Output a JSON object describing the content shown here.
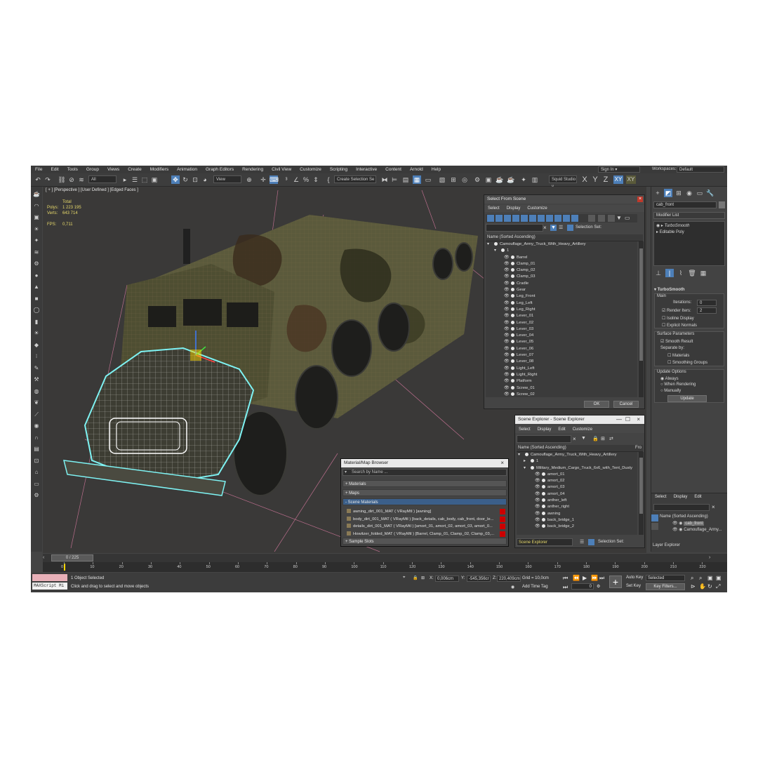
{
  "menu": [
    "File",
    "Edit",
    "Tools",
    "Group",
    "Views",
    "Create",
    "Modifiers",
    "Animation",
    "Graph Editors",
    "Rendering",
    "Civil View",
    "Customize",
    "Scripting",
    "Interactive",
    "Content",
    "Arnold",
    "Help"
  ],
  "signin": "Sign In",
  "workspaces_label": "Workspaces:",
  "workspaces_value": "Default",
  "toolbar": {
    "filter_value": "All",
    "view_value": "View",
    "selection_set": "Create Selection Se",
    "studio": "Squid Studio v",
    "axes": [
      "X",
      "Y",
      "Z",
      "XY",
      "XY"
    ]
  },
  "viewport": {
    "label": "[ + ] [Perspective ] [User Defined ] [Edged Faces ]",
    "stats_total": "Total",
    "polys_label": "Polys:",
    "polys_value": "1 223 195",
    "verts_label": "Verts:",
    "verts_value": "643 714",
    "fps_label": "FPS:",
    "fps_value": "0,711"
  },
  "select_from_scene": {
    "title": "Select From Scene",
    "menu": [
      "Select",
      "Display",
      "Customize"
    ],
    "selection_set_label": "Selection Set:",
    "header": "Name (Sorted Ascending)",
    "root": "Camouflage_Army_Truck_With_Heavy_Artillery",
    "group": "1",
    "items": [
      "Barrel",
      "Clamp_01",
      "Clamp_02",
      "Clamp_03",
      "Cradle",
      "Gear",
      "Leg_Front",
      "Leg_Left",
      "Leg_Right",
      "Lever_01",
      "Lever_02",
      "Lever_03",
      "Lever_04",
      "Lever_05",
      "Lever_06",
      "Lever_07",
      "Lever_08",
      "Light_Left",
      "Light_Right",
      "Platform",
      "Screw_01",
      "Screw_02"
    ],
    "ok": "OK",
    "cancel": "Cancel"
  },
  "scene_explorer": {
    "title": "Scene Explorer - Scene Explorer",
    "menu": [
      "Select",
      "Display",
      "Edit",
      "Customize"
    ],
    "header": "Name (Sorted Ascending)",
    "header_right": "Fro",
    "root": "Camouflage_Army_Truck_With_Heavy_Artillery",
    "group": "1",
    "sub": "Military_Medium_Cargo_Truck_6x6_with_Tent_Dusty",
    "items": [
      "amort_01",
      "amort_02",
      "amort_03",
      "amort_04",
      "anther_left",
      "anther_right",
      "awning",
      "back_bridge_1",
      "back_bridge_2"
    ],
    "footer": "Scene Explorer",
    "selection_set_label": "Selection Set:"
  },
  "material_browser": {
    "title": "Material/Map Browser",
    "search": "Search by Name ...",
    "cats": [
      "+ Materials",
      "+ Maps",
      "- Scene Materials"
    ],
    "items": [
      "awning_dirt_001_MAT  ( VRayMtl ) [awning]",
      "body_dirt_001_MAT  ( VRayMtl ) [back_details, cab_body, cab_front, door_le...",
      "details_dirt_001_MAT  ( VRayMtl ) [amort_01, amort_02, amort_03, amort_0...",
      "Howitzer_folded_MAT  ( VRayMtl ) [Barrel, Clamp_01, Clamp_02, Clamp_03,..."
    ],
    "sample_slots": "+ Sample Slots"
  },
  "command_panel": {
    "object_name": "cab_front",
    "modifier_list": "Modifier List",
    "stack": [
      "TurboSmooth",
      "Editable Poly"
    ],
    "rollout": "TurboSmooth",
    "main": "Main",
    "iterations_label": "Iterations:",
    "iterations_value": "0",
    "render_iters_label": "Render Iters:",
    "render_iters_value": "2",
    "isoline": "Isoline Display",
    "explicit": "Explicit Normals",
    "surface_params": "Surface Parameters",
    "smooth_result": "Smooth Result",
    "separate_by": "Separate by:",
    "materials": "Materials",
    "smoothing_groups": "Smoothing Groups",
    "update_options": "Update Options",
    "always": "Always",
    "when_rendering": "When Rendering",
    "manually": "Manually",
    "update_btn": "Update"
  },
  "layer_explorer": {
    "menu": [
      "Select",
      "Display",
      "Edit"
    ],
    "header": "Name (Sorted Ascending)",
    "items": [
      "cab_front",
      "Camouflage_Army..."
    ],
    "footer": "Layer Explorer"
  },
  "timeline": {
    "frame": "0 / 225",
    "ticks": [
      "0",
      "10",
      "20",
      "30",
      "40",
      "50",
      "60",
      "70",
      "80",
      "90",
      "100",
      "110",
      "120",
      "130",
      "140",
      "150",
      "160",
      "170",
      "180",
      "190",
      "200",
      "210",
      "220"
    ]
  },
  "status": {
    "script": "MAXScript Mi",
    "objects": "1 Object Selected",
    "prompt": "Click and drag to select and move objects",
    "x_label": "X:",
    "x_value": "0,006cm",
    "y_label": "Y:",
    "y_value": "-545,356cr",
    "z_label": "Z:",
    "z_value": "220,409cm",
    "grid": "Grid = 10,0cm",
    "add_time_tag": "Add Time Tag",
    "auto_key": "Auto Key",
    "selected": "Selected",
    "set_key": "Set Key",
    "key_filters": "Key Filters...",
    "frame_field": "0"
  }
}
